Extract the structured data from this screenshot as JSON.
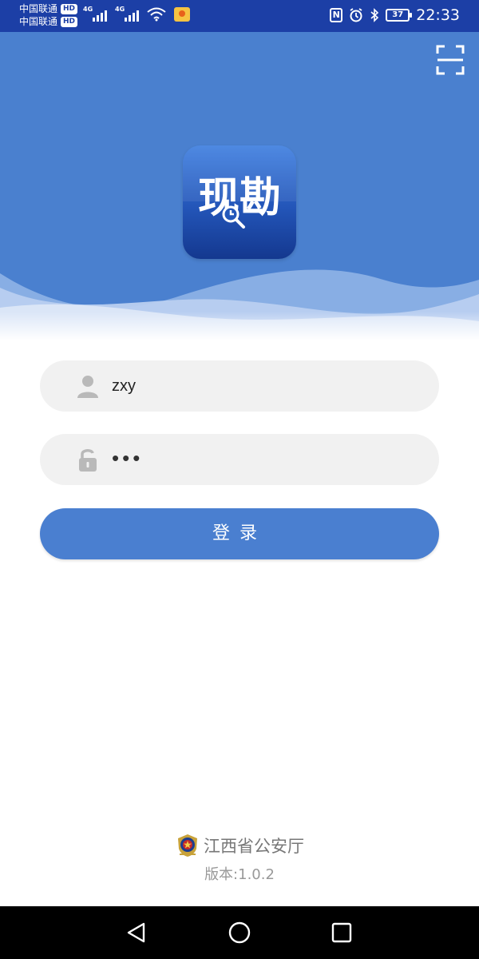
{
  "status_bar": {
    "carrier_1": "中国联通",
    "carrier_2": "中国联通",
    "hd_label": "HD",
    "network_1": "4G",
    "network_2": "4G",
    "battery_level": "37",
    "time": "22:33"
  },
  "header": {
    "app_logo_text": "现勘"
  },
  "login_form": {
    "username_value": "zxy",
    "password_value": "•••",
    "login_label": "登录"
  },
  "footer": {
    "organization": "江西省公安厅",
    "version": "版本:1.0.2"
  },
  "colors": {
    "status_bar": "#1c3fa6",
    "header": "#4a80cf",
    "button": "#4a7fd0",
    "field_bg": "#f1f1f1"
  },
  "icons": {
    "scan": "scan-icon",
    "user": "user-icon",
    "lock": "lock-icon",
    "emblem": "police-emblem-icon",
    "nav_back": "back-triangle-icon",
    "nav_home": "home-circle-icon",
    "nav_recent": "recent-square-icon"
  }
}
